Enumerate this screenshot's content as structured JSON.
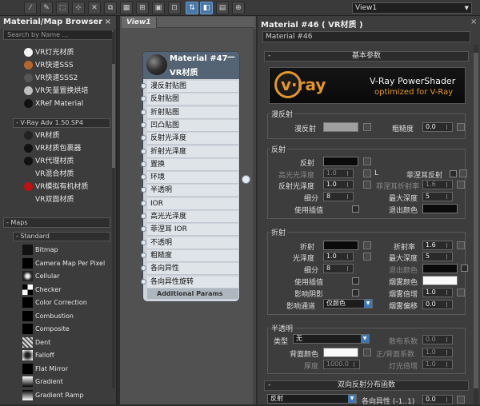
{
  "viewport_combo": "View1",
  "left": {
    "title": "Material/Map Browser",
    "search_placeholder": "Search by Name ...",
    "materials_top": [
      {
        "label": "VR灯光材质",
        "color": "#f2f2f2"
      },
      {
        "label": "VR快速SSS",
        "color": "#b3672a"
      },
      {
        "label": "VR快速SSS2",
        "color": "#555555"
      },
      {
        "label": "VR矢量置换烘培",
        "color": "#bfbfbf"
      },
      {
        "label": "XRef Material",
        "color": "#111111"
      }
    ],
    "vray_group": "- V-Ray Adv 1.50.SP4",
    "materials_vray": [
      {
        "label": "VR材质",
        "color": "#222222"
      },
      {
        "label": "VR材质包裹器",
        "color": "#111111"
      },
      {
        "label": "VR代理材质",
        "color": "#111111"
      },
      {
        "label": "VR混合材质",
        "color": ""
      },
      {
        "label": "VR模拟有机材质",
        "color": "#c01010"
      },
      {
        "label": "VR双面材质",
        "color": ""
      }
    ],
    "maps_header": "- Maps",
    "standard_header": "- Standard",
    "maps": [
      {
        "label": "Bitmap",
        "icon": "bitmap-thumb"
      },
      {
        "label": "Camera Map Per Pixel",
        "icon": "camera-map-thumb"
      },
      {
        "label": "Cellular",
        "icon": "cellular-thumb"
      },
      {
        "label": "Checker",
        "icon": "checker-thumb"
      },
      {
        "label": "Color Correction",
        "icon": "color-correction-thumb"
      },
      {
        "label": "Combustion",
        "icon": "combustion-thumb"
      },
      {
        "label": "Composite",
        "icon": "composite-thumb"
      },
      {
        "label": "Dent",
        "icon": "dent-thumb"
      },
      {
        "label": "Falloff",
        "icon": "falloff-thumb"
      },
      {
        "label": "Flat Mirror",
        "icon": "flat-mirror-thumb"
      },
      {
        "label": "Gradient",
        "icon": "gradient-thumb"
      },
      {
        "label": "Gradient Ramp",
        "icon": "gradient-ramp-thumb"
      }
    ]
  },
  "view": {
    "tab": "View1",
    "node": {
      "title": "Material #47",
      "subtitle": "VR材质",
      "slots": [
        "漫反射贴图",
        "反射贴图",
        "折射贴图",
        "凹凸贴图",
        "反射光泽度",
        "折射光泽度",
        "置换",
        "环境",
        "半透明",
        "IOR",
        "高光光泽度",
        "菲涅耳 IOR",
        "不透明",
        "粗糙度",
        "各向异性",
        "各向异性旋转"
      ],
      "additional": "Additional Params"
    }
  },
  "right": {
    "title": "Material #46 ( VR材质 )",
    "name_field": "Material #46",
    "basic_params": "基本参数",
    "banner": {
      "vray": "v·ray",
      "product": "V-Ray PowerShader",
      "tagline": "optimized for V-Ray"
    },
    "diffuse": {
      "group": "漫反射",
      "label": "漫反射",
      "rough_label": "粗糙度",
      "rough_val": "0.0"
    },
    "reflect": {
      "group": "反射",
      "label": "反射",
      "hilight_label": "高光光泽度",
      "hilight_val": "1.0",
      "l_btn": "L",
      "fresnel_label": "菲涅耳反射",
      "gloss_label": "反射光泽度",
      "gloss_val": "1.0",
      "fresnel_ior_label": "菲涅耳折射率",
      "fresnel_ior_val": "1.6",
      "subdiv_label": "细分",
      "subdiv_val": "8",
      "depth_label": "最大深度",
      "depth_val": "5",
      "interp_label": "使用插值",
      "exit_label": "退出颜色"
    },
    "refract": {
      "group": "折射",
      "label": "折射",
      "ior_label": "折射率",
      "ior_val": "1.6",
      "gloss_label": "光泽度",
      "gloss_val": "1.0",
      "depth_label": "最大深度",
      "depth_val": "5",
      "subdiv_label": "细分",
      "subdiv_val": "8",
      "exit_label": "退出颜色",
      "interp_label": "使用插值",
      "fog_color_label": "烟雾颜色",
      "shadow_label": "影响阴影",
      "fog_mult_label": "烟雾倍增",
      "fog_mult_val": "1.0",
      "channel_label": "影响通道",
      "channel_val": "仅颜色",
      "fog_bias_label": "烟雾偏移",
      "fog_bias_val": "0.0"
    },
    "translucency": {
      "group": "半透明",
      "type_label": "类型",
      "type_val": "无",
      "scatter_label": "散布系数",
      "scatter_val": "0.0",
      "back_label": "背面颜色",
      "fwd_label": "正/背面系数",
      "fwd_val": "1.0",
      "thick_label": "厚度",
      "thick_val": "1000.0",
      "light_label": "灯光倍增",
      "light_val": "1.0"
    },
    "brdf": {
      "header": "双向反射分布函数",
      "type_val": "反射",
      "aniso_label": "各向异性 (-1..1)",
      "aniso_val": "0.0"
    }
  }
}
